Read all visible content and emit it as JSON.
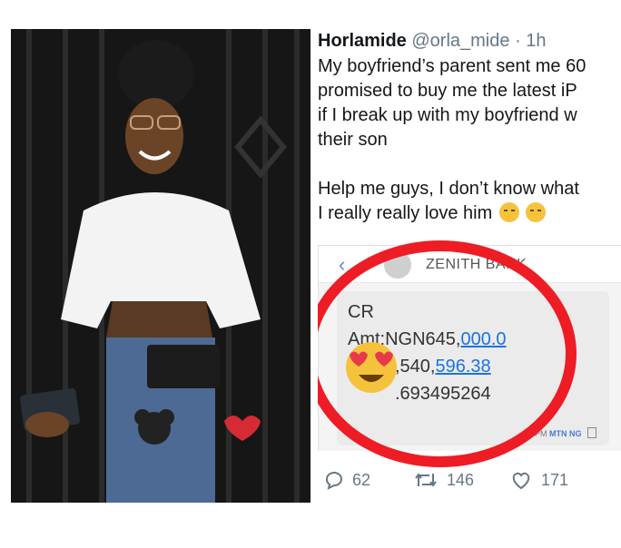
{
  "tweet": {
    "display_name": "Horlamide",
    "handle": "@orla_mide",
    "separator": "·",
    "time": "1h",
    "lines": [
      "My boyfriend’s parent sent me 60",
      "promised to buy me the latest iP",
      "if I break up with my boyfriend w",
      "their son"
    ],
    "lines2": [
      "Help me guys, I don’t know what",
      "I really really love him"
    ],
    "reply_count": "62",
    "retweet_count": "146",
    "like_count": "171"
  },
  "sms": {
    "sender": "ZENITH BANK",
    "line1": "CR",
    "amount_prefix": "Amt:NGN645,",
    "amount_link": "000.0",
    "balance_prefix": ",540,",
    "balance_link": "596.38",
    "ref": ".693495264",
    "time": "54 PM",
    "carrier": "MTN NG"
  },
  "colors": {
    "ring": "#ee1c24",
    "link": "#1a73e8",
    "emoji": "#f5c33b",
    "heart": "#e8394b"
  }
}
